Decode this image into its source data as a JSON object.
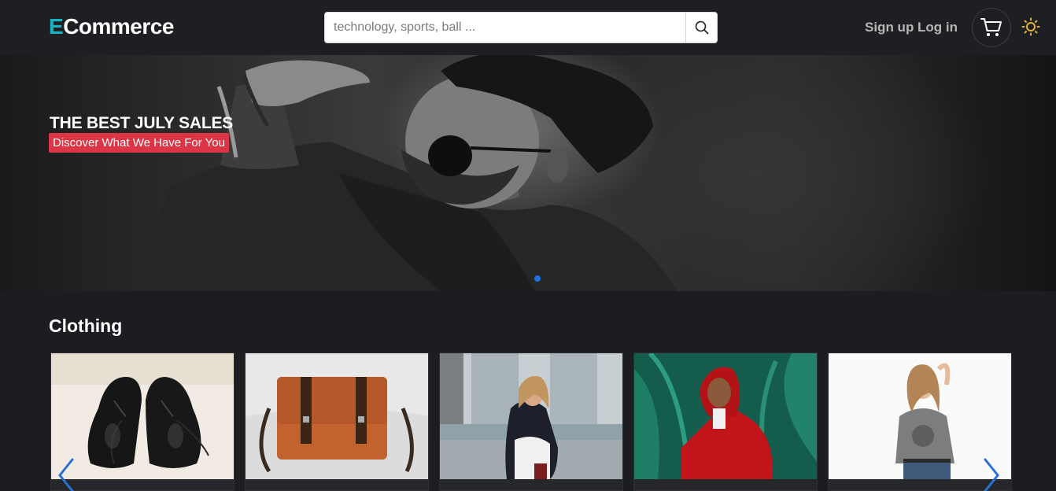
{
  "header": {
    "logo_first_letter": "E",
    "logo_rest": "Commerce",
    "search_placeholder": "technology, sports, ball ...",
    "signup_label": "Sign up",
    "login_label": "Log in",
    "search_icon": "search-icon",
    "cart_icon": "cart-icon",
    "theme_icon": "sun-icon"
  },
  "hero": {
    "title": "THE BEST JULY SALES",
    "subtitle": "Discover What We Have For You"
  },
  "section": {
    "title": "Clothing"
  },
  "colors": {
    "accent": "#17b3c4",
    "badge": "#dc3545",
    "indicator": "#1a73e8",
    "sun": "#e2b13c"
  }
}
